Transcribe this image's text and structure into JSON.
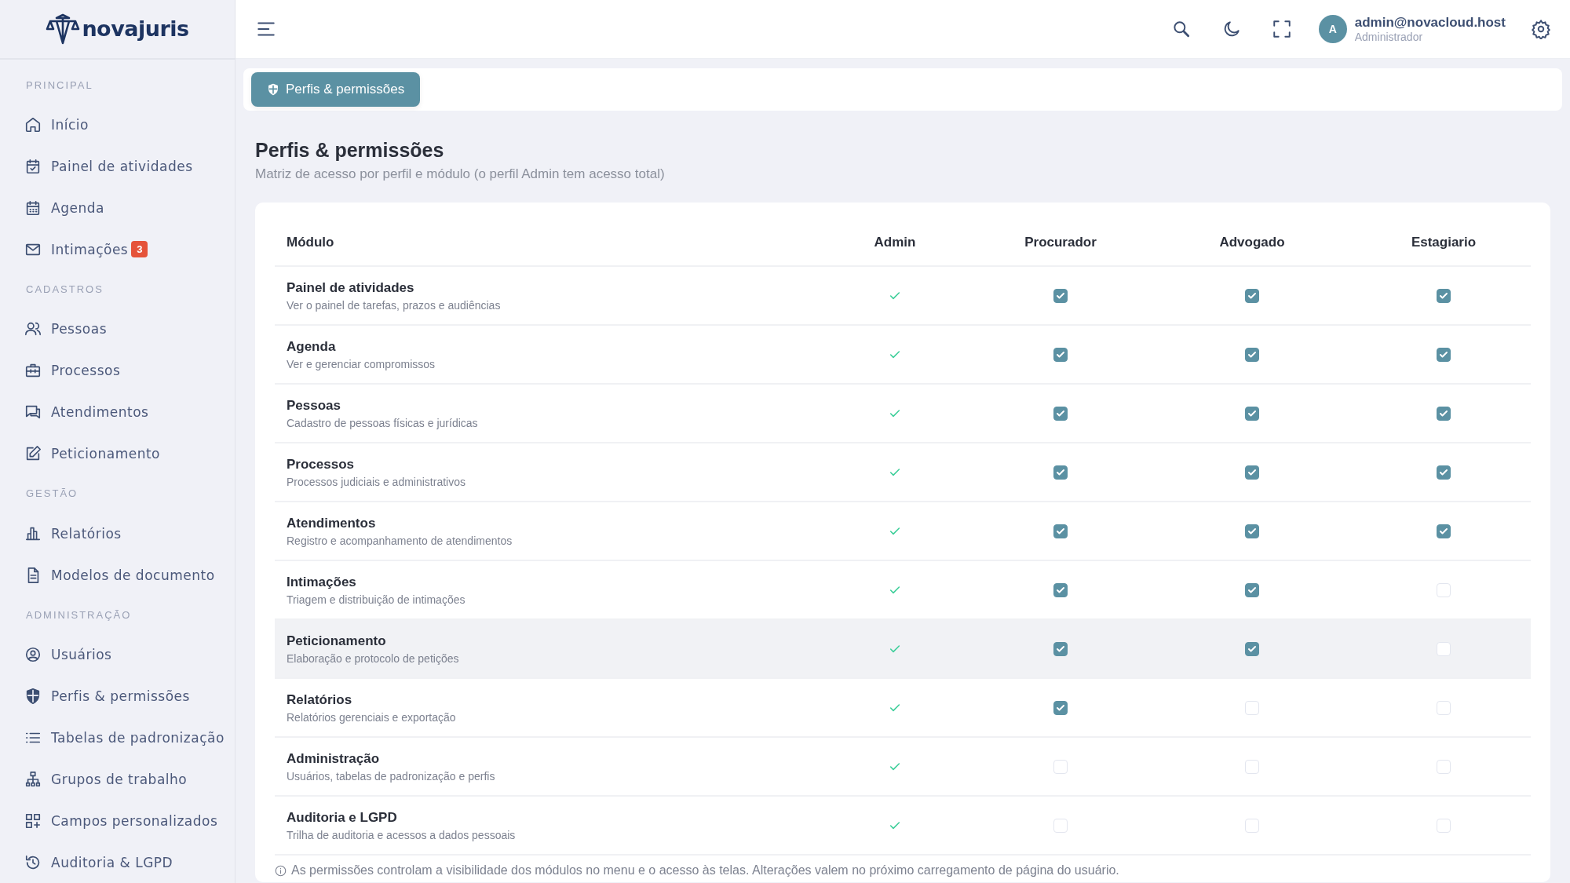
{
  "sidebar": {
    "logo": "novajuris",
    "sections": [
      {
        "title": "PRINCIPAL",
        "items": [
          {
            "label": "Início"
          },
          {
            "label": "Painel de atividades"
          },
          {
            "label": "Agenda"
          },
          {
            "label": "Intimações",
            "badge": "3"
          }
        ]
      },
      {
        "title": "CADASTROS",
        "items": [
          {
            "label": "Pessoas"
          },
          {
            "label": "Processos"
          },
          {
            "label": "Atendimentos"
          },
          {
            "label": "Peticionamento"
          }
        ]
      },
      {
        "title": "GESTÃO",
        "items": [
          {
            "label": "Relatórios"
          },
          {
            "label": "Modelos de documento"
          }
        ]
      },
      {
        "title": "ADMINISTRAÇÃO",
        "items": [
          {
            "label": "Usuários"
          },
          {
            "label": "Perfis & permissões"
          },
          {
            "label": "Tabelas de padronização"
          },
          {
            "label": "Grupos de trabalho"
          },
          {
            "label": "Campos personalizados"
          },
          {
            "label": "Auditoria & LGPD"
          }
        ]
      }
    ]
  },
  "topbar": {
    "avatar": "A",
    "user": "admin@novacloud.host",
    "role": "Administrador"
  },
  "breadcrumb": "Perfis & permissões",
  "page": {
    "title": "Perfis & permissões",
    "subtitle": "Matriz de acesso por perfil e módulo (o perfil Admin tem acesso total)"
  },
  "table": {
    "columns": [
      "Módulo",
      "Admin",
      "Procurador",
      "Advogado",
      "Estagiario"
    ],
    "rows": [
      {
        "name": "Painel de atividades",
        "description": "Ver o painel de tarefas, prazos e audiências",
        "admin": true,
        "permissions": [
          true,
          true,
          true
        ],
        "hovered": false
      },
      {
        "name": "Agenda",
        "description": "Ver e gerenciar compromissos",
        "admin": true,
        "permissions": [
          true,
          true,
          true
        ],
        "hovered": false
      },
      {
        "name": "Pessoas",
        "description": "Cadastro de pessoas físicas e jurídicas",
        "admin": true,
        "permissions": [
          true,
          true,
          true
        ],
        "hovered": false
      },
      {
        "name": "Processos",
        "description": "Processos judiciais e administrativos",
        "admin": true,
        "permissions": [
          true,
          true,
          true
        ],
        "hovered": false
      },
      {
        "name": "Atendimentos",
        "description": "Registro e acompanhamento de atendimentos",
        "admin": true,
        "permissions": [
          true,
          true,
          true
        ],
        "hovered": false
      },
      {
        "name": "Intimações",
        "description": "Triagem e distribuição de intimações",
        "admin": true,
        "permissions": [
          true,
          true,
          false
        ],
        "hovered": false
      },
      {
        "name": "Peticionamento",
        "description": "Elaboração e protocolo de petições",
        "admin": true,
        "permissions": [
          true,
          true,
          false
        ],
        "hovered": true
      },
      {
        "name": "Relatórios",
        "description": "Relatórios gerenciais e exportação",
        "admin": true,
        "permissions": [
          true,
          false,
          false
        ],
        "hovered": false
      },
      {
        "name": "Administração",
        "description": "Usuários, tabelas de padronização e perfis",
        "admin": true,
        "permissions": [
          false,
          false,
          false
        ],
        "hovered": false
      },
      {
        "name": "Auditoria e LGPD",
        "description": "Trilha de auditoria e acessos a dados pessoais",
        "admin": true,
        "permissions": [
          false,
          false,
          false
        ],
        "hovered": false
      }
    ],
    "note": "As permissões controlam a visibilidade dos módulos no menu e o acesso às telas. Alterações valem no próximo carregamento de página do usuário."
  }
}
